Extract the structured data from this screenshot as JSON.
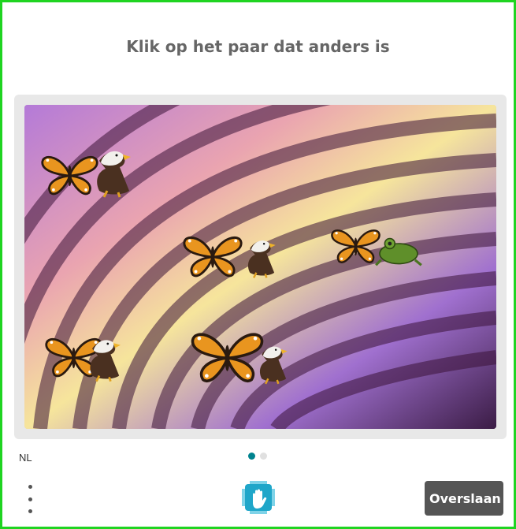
{
  "prompt": "Klik op het paar dat anders is",
  "language": "NL",
  "pagination": {
    "total": 2,
    "current": 1
  },
  "skip_label": "Overslaan",
  "colors": {
    "accent": "#00838f",
    "frame": "#1fd421",
    "button": "#555555"
  },
  "challenge": {
    "pairs": [
      {
        "items": [
          "butterfly",
          "eagle"
        ]
      },
      {
        "items": [
          "butterfly",
          "eagle"
        ]
      },
      {
        "items": [
          "butterfly",
          "frog"
        ]
      },
      {
        "items": [
          "butterfly",
          "eagle"
        ]
      },
      {
        "items": [
          "butterfly",
          "eagle"
        ]
      }
    ]
  },
  "icons": {
    "menu": "vertical-dots-icon",
    "logo": "hand-logo-icon"
  }
}
